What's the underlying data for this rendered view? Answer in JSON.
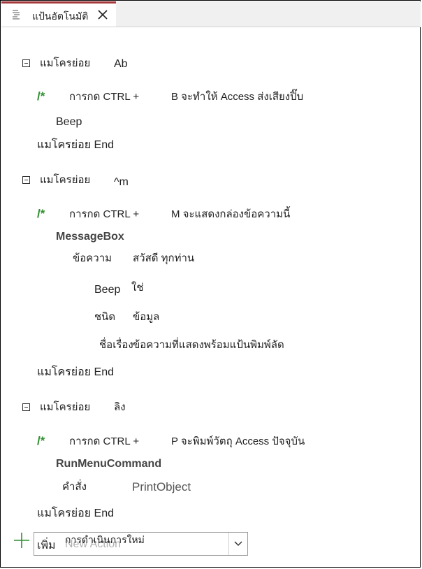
{
  "tab": {
    "icon": "macro-icon",
    "label": "แป้นอัตโนมัติ",
    "close_icon": "close-icon"
  },
  "macros": [
    {
      "header_label": "แมโครย่อย",
      "name": "Ab",
      "comment_prefix": "การกด CTRL +",
      "comment_text": "B จะทำให้ Access ส่งเสียงปิ๊บ",
      "action": "Beep",
      "end_label": "แมโครย่อย End"
    },
    {
      "header_label": "แมโครย่อย",
      "name": "^m",
      "comment_prefix": "การกด CTRL +",
      "comment_text": "M จะแสดงกล่องข้อความนี้",
      "action": "MessageBox",
      "args": [
        {
          "label": "ข้อความ",
          "value": "สวัสดี ทุกท่าน"
        },
        {
          "label": "Beep",
          "value": "ใช่"
        },
        {
          "label": "ชนิด",
          "value": "ข้อมูล"
        },
        {
          "label": "ชื่อเรื่อง",
          "value": "ข้อความที่แสดงพร้อมแป้นพิมพ์ลัด"
        }
      ],
      "end_label": "แมโครย่อย End"
    },
    {
      "header_label": "แมโครย่อย",
      "name": "ลิง",
      "comment_prefix": "การกด CTRL +",
      "comment_text": "P จะพิมพ์วัตถุ Access ปัจจุบัน",
      "action": "RunMenuCommand",
      "args": [
        {
          "label": "คำสั่ง",
          "value": "PrintObject"
        }
      ],
      "end_label": "แมโครย่อย End"
    }
  ],
  "comment_open": "/*",
  "add_action": {
    "add_label": "เพิ่ม",
    "placeholder": "New Action",
    "overlay_text": "การดำเนินการใหม่",
    "plus_icon": "plus-icon",
    "dropdown_icon": "chevron-down-icon"
  }
}
